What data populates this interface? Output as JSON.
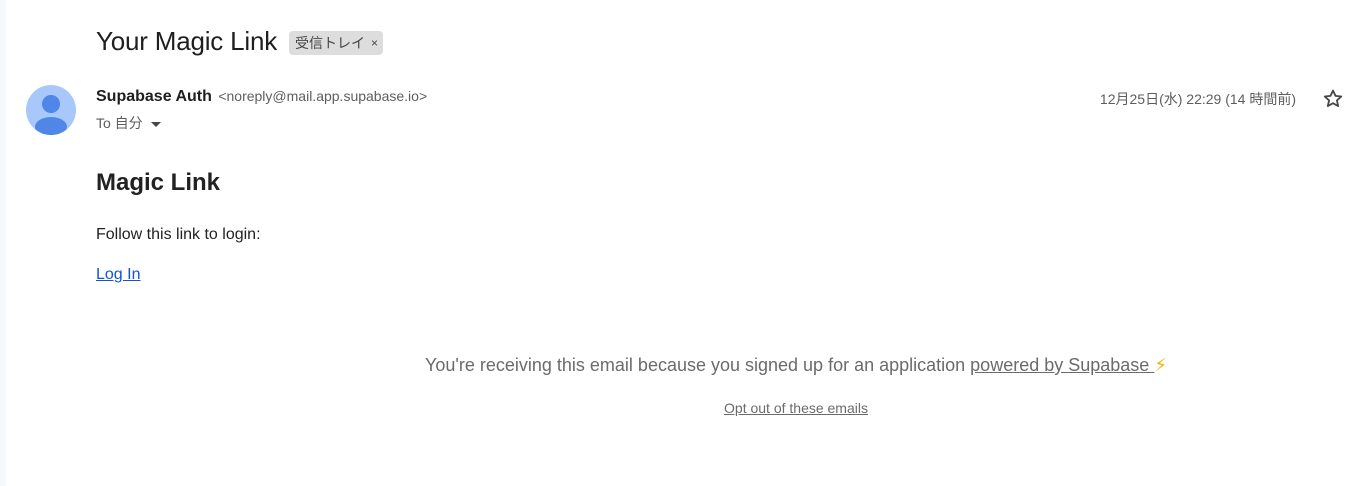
{
  "email": {
    "subject": "Your Magic Link",
    "label": "受信トレイ",
    "label_close": "×",
    "sender_name": "Supabase Auth",
    "sender_email": "<noreply@mail.app.supabase.io>",
    "to_text": "To 自分",
    "timestamp": "12月25日(水) 22:29 (14 時間前)"
  },
  "content": {
    "title": "Magic Link",
    "instruction": "Follow this link to login:",
    "link_label": "Log In"
  },
  "footer": {
    "notice_prefix": "You're receiving this email because you signed up for an application ",
    "powered_by_link": "powered by Supabase ",
    "bolt": "⚡",
    "opt_out": "Opt out of these emails"
  },
  "icons": {
    "avatar": "person-avatar-icon",
    "star": "star-outline-icon",
    "caret": "caret-down-icon",
    "bolt": "lightning-icon"
  },
  "colors": {
    "link": "#1155cc",
    "avatar_bg": "#a8c7fa",
    "avatar_fg": "#4f86e8"
  }
}
